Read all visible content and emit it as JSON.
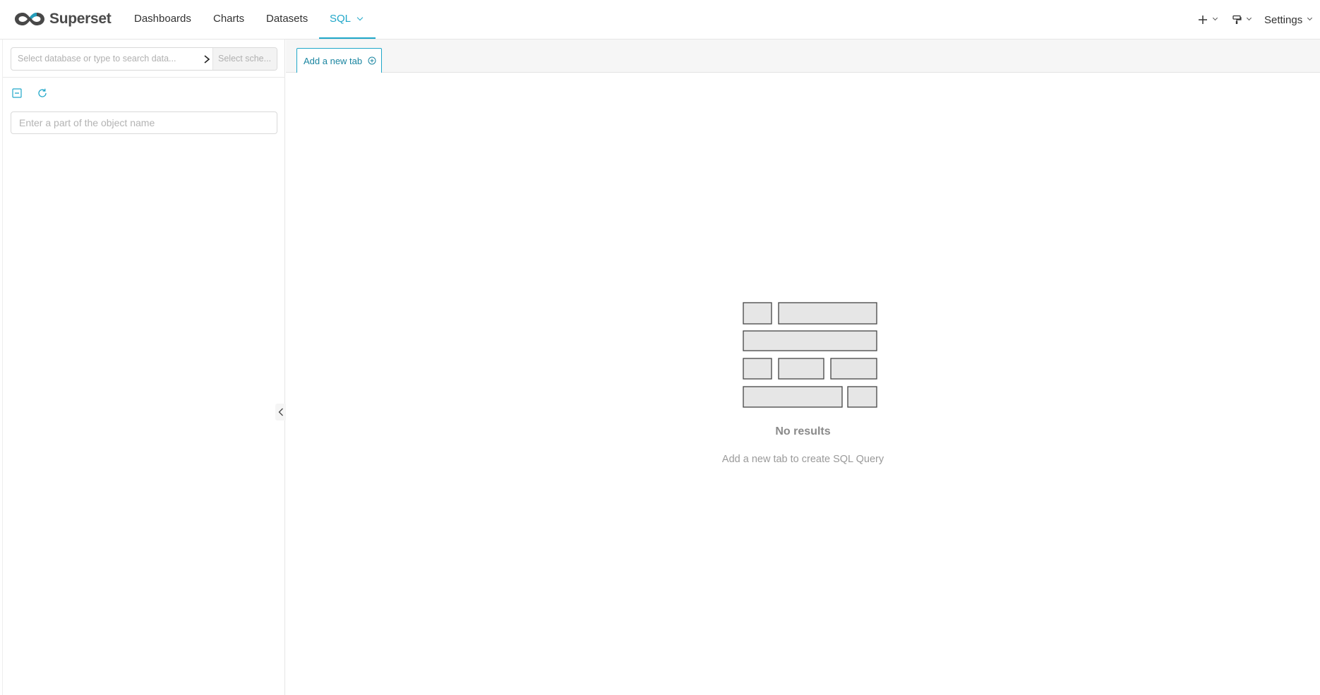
{
  "brand": {
    "name": "Superset"
  },
  "nav": {
    "items": [
      {
        "label": "Dashboards"
      },
      {
        "label": "Charts"
      },
      {
        "label": "Datasets"
      },
      {
        "label": "SQL",
        "active": true
      }
    ],
    "settings_label": "Settings"
  },
  "left_panel": {
    "database_placeholder": "Select database or type to search data...",
    "schema_placeholder": "Select sche...",
    "search_placeholder": "Enter a part of the object name"
  },
  "tabs": {
    "add_label": "Add a new tab"
  },
  "empty_state": {
    "title": "No results",
    "description": "Add a new tab to create SQL Query"
  },
  "colors": {
    "accent": "#20a7c9",
    "text": "#323232",
    "muted": "#8a8a8a"
  },
  "icons": [
    "superset-logo-icon",
    "plus-icon",
    "paint-brush-icon",
    "chevron-down-icon",
    "chevron-right-icon",
    "collapse-all-icon",
    "refresh-icon",
    "add-circle-icon",
    "chevron-left-icon",
    "empty-grid-icon"
  ]
}
